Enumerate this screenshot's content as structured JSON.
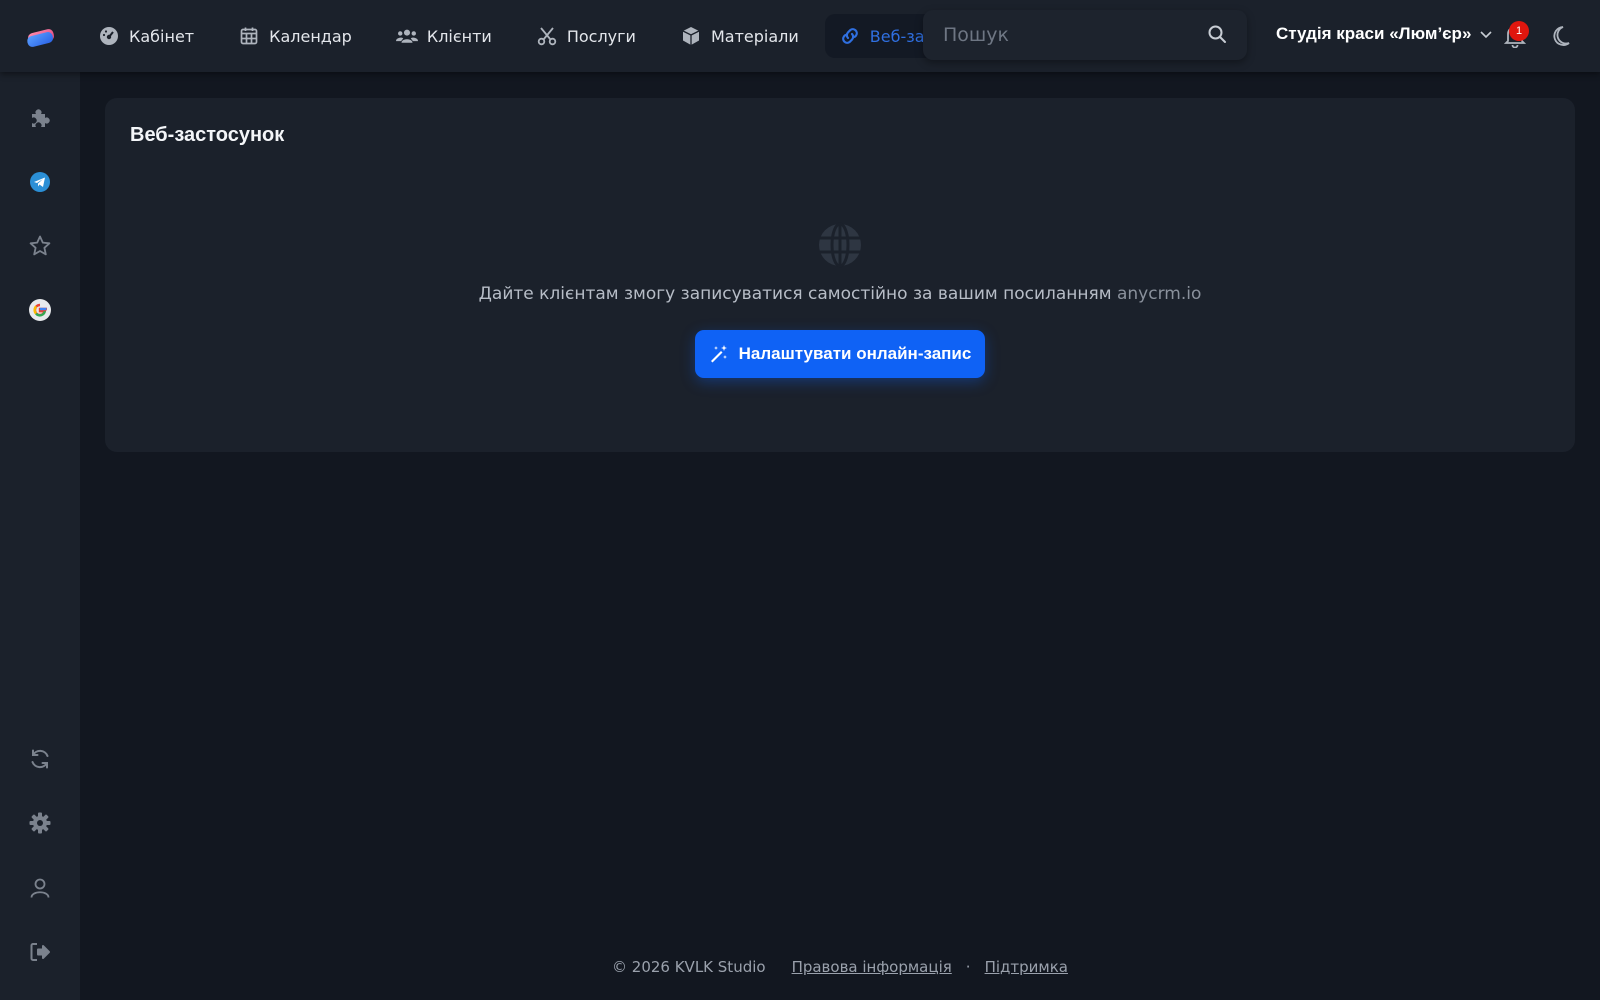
{
  "colors": {
    "accent": "#0f62f5",
    "active_nav": "#2f6fe0",
    "background": "#121720",
    "panel": "#1b212b",
    "notification": "#e0160e"
  },
  "header": {
    "logo_icon": "anycrm-logo-icon",
    "nav": [
      {
        "label": "Кабінет",
        "icon": "dashboard-gauge-icon"
      },
      {
        "label": "Календар",
        "icon": "calendar-icon"
      },
      {
        "label": "Клієнти",
        "icon": "users-icon"
      },
      {
        "label": "Послуги",
        "icon": "scissors-icon"
      },
      {
        "label": "Матеріали",
        "icon": "box-icon"
      },
      {
        "label": "Веб-заст",
        "icon": "link-icon",
        "active": true
      }
    ],
    "search": {
      "placeholder": "Пошук",
      "value": ""
    },
    "studio_name": "Студія краси «Люм’єр»",
    "notification_count": "1"
  },
  "sidebar": {
    "top_items": [
      "puzzle-icon",
      "telegram-icon",
      "star-icon",
      "google-icon"
    ],
    "bottom_items": [
      "sync-icon",
      "gear-icon",
      "user-icon",
      "logout-icon"
    ]
  },
  "main": {
    "title": "Веб-застосунок",
    "empty_state": {
      "icon": "globe-icon",
      "text": "Дайте клієнтам змогу записуватися самостійно за вашим посиланням",
      "domain": "anycrm.io",
      "button_label": "Налаштувати онлайн-запис"
    }
  },
  "footer": {
    "copyright": "© 2026 KVLK Studio",
    "links": [
      "Правова інформація",
      "Підтримка"
    ],
    "separator": "·"
  }
}
